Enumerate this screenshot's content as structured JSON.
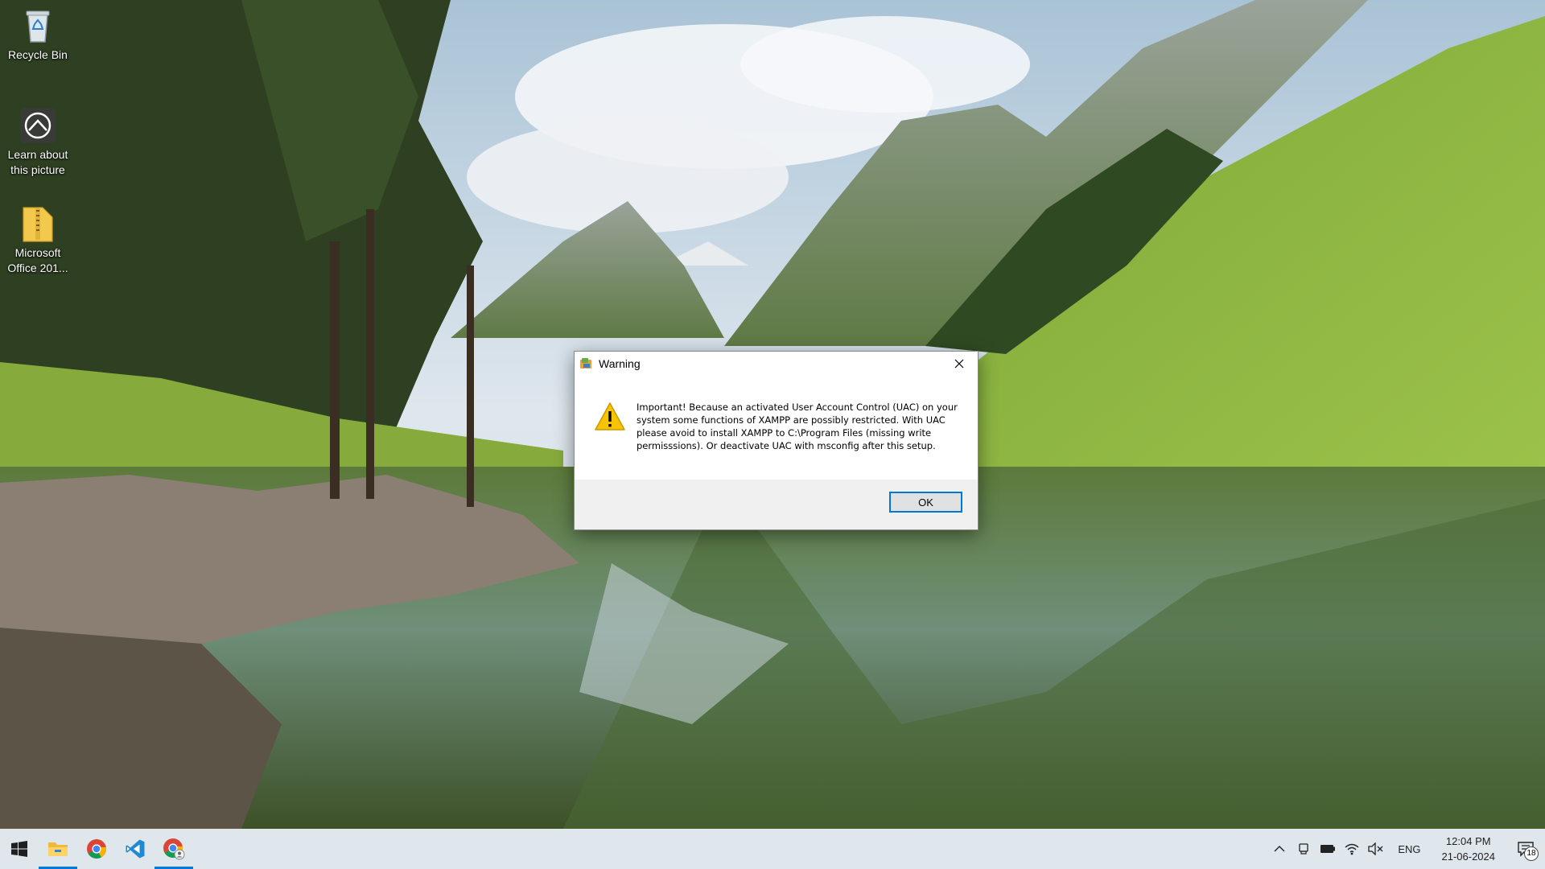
{
  "desktop": {
    "icons": [
      {
        "label": "Recycle Bin",
        "icon": "recycle-bin-icon"
      },
      {
        "label": "Learn about this picture",
        "icon": "learn-about-picture-icon"
      },
      {
        "label": "Microsoft Office 201...",
        "icon": "zip-folder-icon"
      }
    ]
  },
  "dialog": {
    "title": "Warning",
    "app_icon": "xampp-installer-icon",
    "warning_icon": "warning-triangle-icon",
    "message": "Important! Because an activated User Account Control (UAC) on your system some functions of XAMPP are possibly restricted. With UAC please avoid to install XAMPP to C:\\Program Files (missing write permisssions). Or deactivate UAC with msconfig after this setup.",
    "ok_label": "OK",
    "close_icon": "close-icon",
    "accent": "#0078d7"
  },
  "taskbar": {
    "apps": [
      {
        "name": "start",
        "icon": "windows-start-icon",
        "active": false
      },
      {
        "name": "file-explorer",
        "icon": "file-explorer-icon",
        "active": true
      },
      {
        "name": "chrome",
        "icon": "chrome-icon",
        "active": false
      },
      {
        "name": "vscode",
        "icon": "vscode-icon",
        "active": false
      },
      {
        "name": "chrome-profile",
        "icon": "chrome-profile-icon",
        "active": true
      }
    ],
    "tray": {
      "language": "ENG",
      "time": "12:04 PM",
      "date": "21-06-2024",
      "notification_count": "18"
    },
    "background": "#dfe7ec"
  }
}
